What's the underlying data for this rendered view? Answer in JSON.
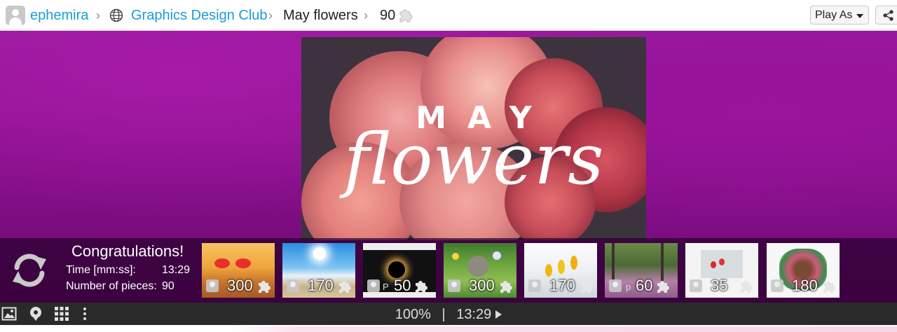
{
  "breadcrumb": {
    "user": "ephemira",
    "club": "Graphics Design Club",
    "puzzle": "May flowers",
    "pieces": "90"
  },
  "header": {
    "play_as_label": "Play As"
  },
  "puzzle_image": {
    "line1": "MAY",
    "line2": "flowers"
  },
  "completion": {
    "title": "Congratulations!",
    "time_label": "Time [mm:ss]:",
    "time_value": "13:29",
    "pieces_label": "Number of pieces:",
    "pieces_value": "90"
  },
  "suggestions": [
    {
      "count": "300",
      "scene": "sunset sunglasses"
    },
    {
      "count": "170",
      "scene": "beach sky"
    },
    {
      "count": "50",
      "tag": "P",
      "scene": "solar eclipse"
    },
    {
      "count": "300",
      "scene": "kitten flowers"
    },
    {
      "count": "170",
      "scene": "yellow crocuses snow"
    },
    {
      "count": "60",
      "tag": "p",
      "scene": "blooming forest path"
    },
    {
      "count": "35",
      "scene": "tulips snow"
    },
    {
      "count": "180",
      "scene": "horse flowers"
    }
  ],
  "status_bar": {
    "zoom": "100%",
    "separator": "|",
    "timer": "13:29"
  },
  "colors": {
    "link": "#1a9cd8",
    "stage": "#8a108e",
    "statusbar": "#2a2a2a"
  }
}
